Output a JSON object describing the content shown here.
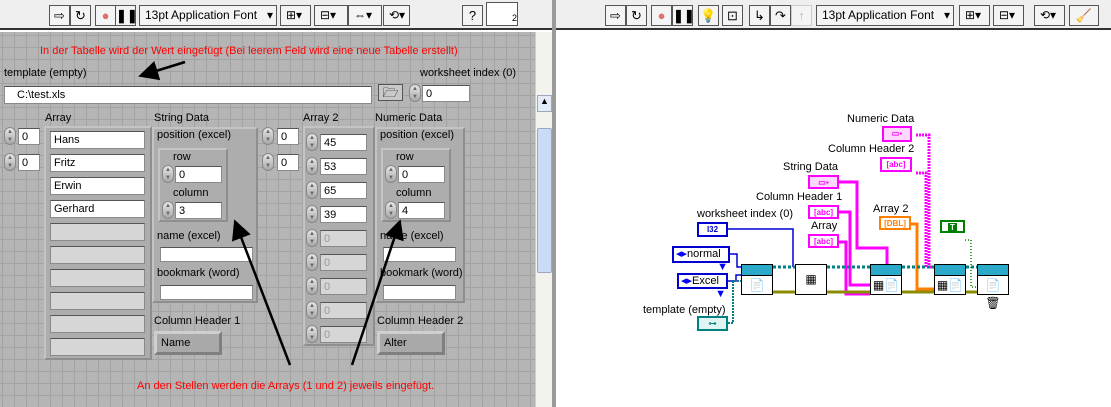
{
  "front_panel": {
    "toolbar": {
      "font": "13pt Application Font",
      "help": "?",
      "icon_badge": "2"
    },
    "annotation_top": "In der Tabelle wird der Wert eingefügt (Bei leerem Feld wird eine neue Tabelle erstellt)",
    "annotation_bottom": "An den Stellen werden die Arrays (1 und 2) jeweils eingefügt.",
    "template": {
      "label": "template (empty)",
      "value": "C:\\test.xls"
    },
    "worksheet_index": {
      "label": "worksheet index (0)",
      "value": "0"
    },
    "array": {
      "label": "Array",
      "indices": [
        "0",
        "0"
      ],
      "values": [
        "Hans",
        "Fritz",
        "Erwin",
        "Gerhard",
        "",
        "",
        "",
        "",
        "",
        ""
      ]
    },
    "string_data": {
      "label": "String Data",
      "position_label": "position (excel)",
      "row_label": "row",
      "row": "0",
      "column_label": "column",
      "column": "3",
      "name_label": "name (excel)",
      "name": "",
      "bookmark_label": "bookmark (word)",
      "bookmark": ""
    },
    "column_header_1": {
      "label": "Column Header 1",
      "value": "Name"
    },
    "array2": {
      "label": "Array 2",
      "indices": [
        "0",
        "0"
      ],
      "values": [
        "45",
        "53",
        "65",
        "39",
        "0",
        "0",
        "0",
        "0",
        "0"
      ]
    },
    "numeric_data": {
      "label": "Numeric Data",
      "position_label": "position (excel)",
      "row_label": "row",
      "row": "0",
      "column_label": "column",
      "column": "4",
      "name_label": "name (excel)",
      "name": "",
      "bookmark_label": "bookmark (word)",
      "bookmark": ""
    },
    "column_header_2": {
      "label": "Column Header 2",
      "value": "Alter"
    }
  },
  "block_diagram": {
    "toolbar": {
      "font": "13pt Application Font"
    },
    "labels": {
      "numeric_data": "Numeric Data",
      "column_header_2": "Column Header 2",
      "string_data": "String Data",
      "column_header_1": "Column Header 1",
      "array2": "Array 2",
      "array": "Array",
      "worksheet_index": "worksheet index (0)",
      "template": "template (empty)"
    },
    "terminals": {
      "abc": "[abc]",
      "dbl": "[DBL]",
      "i32": "I32",
      "bool": "T"
    },
    "enums": {
      "mode": "normal",
      "app": "Excel"
    },
    "colors": {
      "string": "#ff00ff",
      "double": "#ff8000",
      "integer": "#0000d0",
      "refnum": "#008080",
      "boolean": "#008000",
      "error": "#8c8c00"
    }
  }
}
